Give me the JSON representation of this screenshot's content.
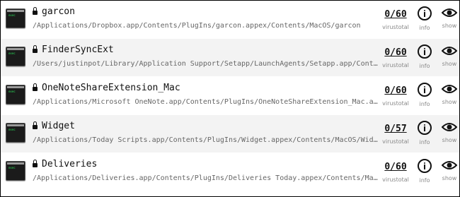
{
  "labels": {
    "virustotal": "virustotal",
    "info": "info",
    "show": "show",
    "exec_icon_text": "exec"
  },
  "rows": [
    {
      "name": "garcon",
      "path": "/Applications/Dropbox.app/Contents/PlugIns/garcon.appex/Contents/MacOS/garcon",
      "score": "0/60"
    },
    {
      "name": "FinderSyncExt",
      "path": "/Users/justinpot/Library/Application Support/Setapp/LaunchAgents/Setapp.app/Contents/PlugIns/F…",
      "score": "0/60"
    },
    {
      "name": "OneNoteShareExtension_Mac",
      "path": "/Applications/Microsoft OneNote.app/Contents/PlugIns/OneNoteShareExtension_Mac.appex/Contents/M…",
      "score": "0/60"
    },
    {
      "name": "Widget",
      "path": "/Applications/Today Scripts.app/Contents/PlugIns/Widget.appex/Contents/MacOS/Widget",
      "score": "0/57"
    },
    {
      "name": "Deliveries",
      "path": "/Applications/Deliveries.app/Contents/PlugIns/Deliveries Today.appex/Contents/MacOS/Deliveries…",
      "score": "0/60"
    }
  ]
}
